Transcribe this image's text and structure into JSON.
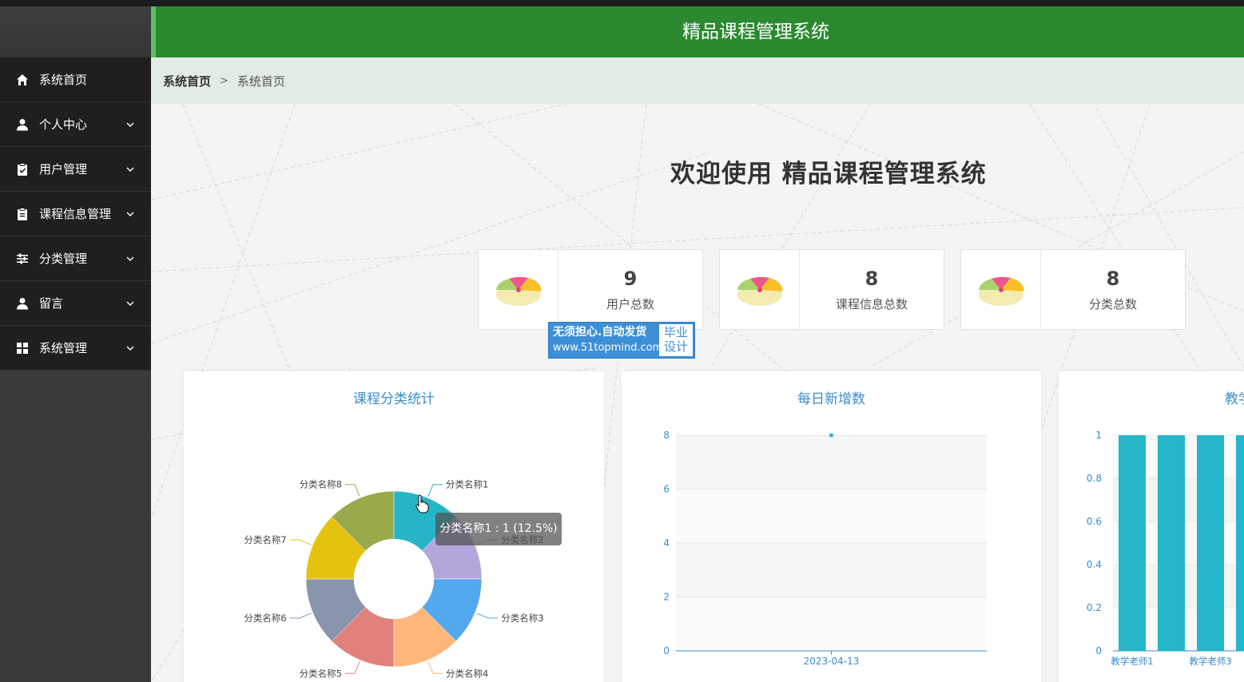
{
  "header": {
    "title": "精品课程管理系统"
  },
  "sidebar": {
    "items": [
      {
        "label": "系统首页",
        "icon": "home-icon",
        "has_arrow": false
      },
      {
        "label": "个人中心",
        "icon": "user-icon",
        "has_arrow": true
      },
      {
        "label": "用户管理",
        "icon": "clipboard-check-icon",
        "has_arrow": true
      },
      {
        "label": "课程信息管理",
        "icon": "clipboard-icon",
        "has_arrow": true
      },
      {
        "label": "分类管理",
        "icon": "sliders-icon",
        "has_arrow": true
      },
      {
        "label": "留言",
        "icon": "user-icon",
        "has_arrow": true
      },
      {
        "label": "系统管理",
        "icon": "grid-icon",
        "has_arrow": true
      }
    ]
  },
  "breadcrumb": {
    "home": "系统首页",
    "separator": ">",
    "current": "系统首页"
  },
  "welcome": "欢迎使用 精品课程管理系统",
  "stats": [
    {
      "value": "9",
      "label": "用户总数"
    },
    {
      "value": "8",
      "label": "课程信息总数"
    },
    {
      "value": "8",
      "label": "分类总数"
    }
  ],
  "watermark": {
    "top": "无须担心.自动发货",
    "bottom": "www.51topmind.com",
    "right_line1": "毕业",
    "right_line2": "设计"
  },
  "tooltip": "分类名称1 : 1 (12.5%)",
  "colors": {
    "header": "#2b8a2f",
    "sidebar": "#1f1f1f",
    "accent": "#23b7c8",
    "title_blue": "#3a8ecc"
  },
  "chart_data": [
    {
      "type": "pie",
      "title": "课程分类统计",
      "donut": true,
      "categories": [
        "分类名称1",
        "分类名称2",
        "分类名称3",
        "分类名称4",
        "分类名称5",
        "分类名称6",
        "分类名称7",
        "分类名称8"
      ],
      "values": [
        1,
        1,
        1,
        1,
        1,
        1,
        1,
        1
      ],
      "colors": [
        "#26b5c6",
        "#b4a6da",
        "#53a8ee",
        "#fdb77a",
        "#e0827b",
        "#8994ad",
        "#e5c20d",
        "#98aa4c"
      ]
    },
    {
      "type": "scatter",
      "title": "每日新增数",
      "x": [
        "2023-04-13"
      ],
      "y": [
        8
      ],
      "yticks": [
        "0",
        "2",
        "4",
        "6",
        "8"
      ],
      "ylim": [
        0,
        8
      ],
      "grid": true
    },
    {
      "type": "bar",
      "title": "教学",
      "categories": [
        "教学老师1",
        "",
        "教学老师3",
        ""
      ],
      "values": [
        1,
        1,
        1,
        1
      ],
      "yticks": [
        "0",
        "0.2",
        "0.4",
        "0.6",
        "0.8",
        "1"
      ],
      "ylim": [
        0,
        1
      ],
      "grid": true
    }
  ]
}
